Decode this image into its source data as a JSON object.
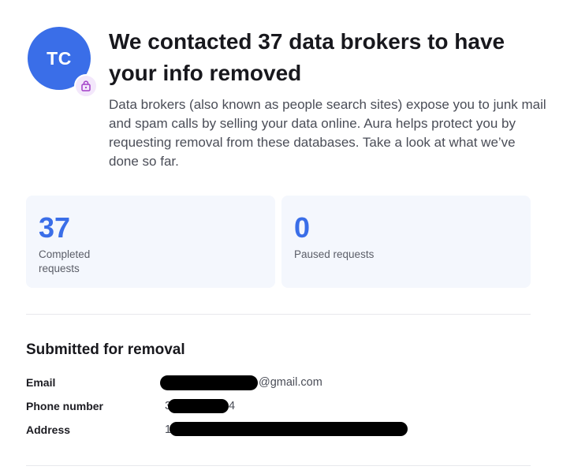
{
  "profile": {
    "initials": "TC",
    "badge_icon": "privacy-lock-icon"
  },
  "header": {
    "title": "We contacted 37 data brokers to have your info removed",
    "description": "Data brokers (also known as people search sites) expose you to junk mail and spam calls by selling your data online. Aura helps protect you by requesting removal from these databases. Take a look at what we’ve done so far."
  },
  "stats": {
    "completed": {
      "value": "37",
      "label": "Completed requests"
    },
    "paused": {
      "value": "0",
      "label": "Paused requests"
    }
  },
  "submitted": {
    "title": "Submitted for removal",
    "email": {
      "label": "Email",
      "value_suffix": "@gmail.com"
    },
    "phone": {
      "label": "Phone number",
      "value_prefix": "3",
      "value_suffix": "4"
    },
    "address": {
      "label": "Address",
      "value_prefix": "1"
    }
  },
  "colors": {
    "accent": "#3a6ee8",
    "card_bg": "#f4f7fd",
    "badge_bg": "#f3e7fb",
    "badge_icon": "#a23fc8",
    "redaction": "#000000"
  }
}
